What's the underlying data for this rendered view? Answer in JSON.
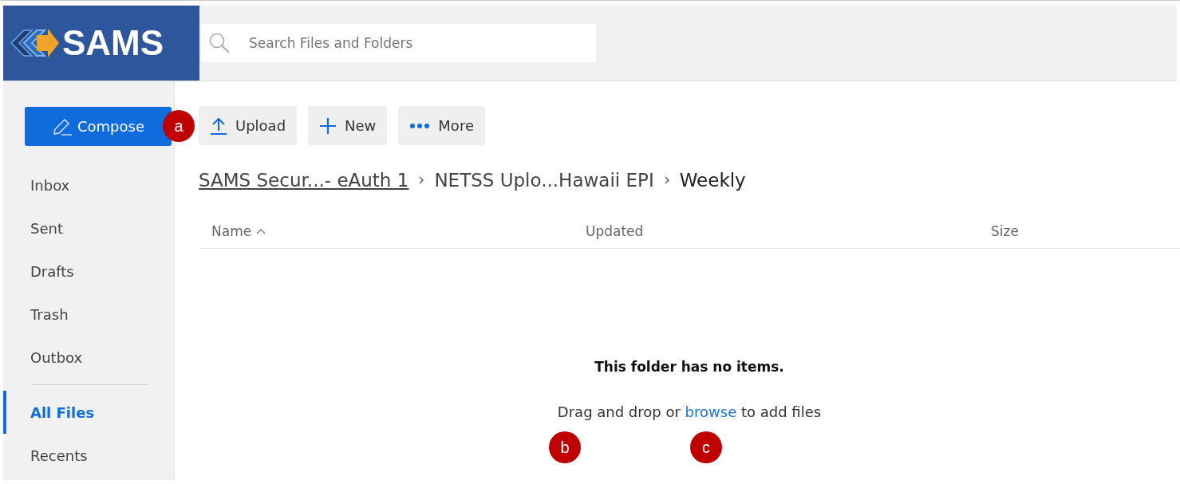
{
  "logo": {
    "text": "SAMS"
  },
  "search": {
    "placeholder": "Search Files and Folders"
  },
  "compose": {
    "label": "Compose"
  },
  "toolbar": [
    {
      "label": "Upload"
    },
    {
      "label": "New"
    },
    {
      "label": "More"
    }
  ],
  "sidebar": {
    "items": [
      {
        "label": "Inbox",
        "selected": false
      },
      {
        "label": "Sent",
        "selected": false
      },
      {
        "label": "Drafts",
        "selected": false
      },
      {
        "label": "Trash",
        "selected": false
      },
      {
        "label": "Outbox",
        "selected": false
      },
      {
        "label": "All Files",
        "selected": true
      },
      {
        "label": "Recents",
        "selected": false
      }
    ]
  },
  "breadcrumb": [
    {
      "label": "SAMS Secur...- eAuth 1",
      "kind": "link"
    },
    {
      "label": "NETSS Uplo...Hawaii EPI",
      "kind": "text"
    },
    {
      "label": "Weekly",
      "kind": "current"
    }
  ],
  "table": {
    "columns": [
      {
        "label": "Name",
        "sorted": true
      },
      {
        "label": "Updated",
        "sorted": false
      },
      {
        "label": "Size",
        "sorted": false
      }
    ]
  },
  "empty": {
    "title": "This folder has no items.",
    "before": "Drag and drop or",
    "link": "browse",
    "after": "to add files"
  },
  "markers": [
    {
      "label": "a"
    },
    {
      "label": "b"
    },
    {
      "label": "c"
    }
  ]
}
